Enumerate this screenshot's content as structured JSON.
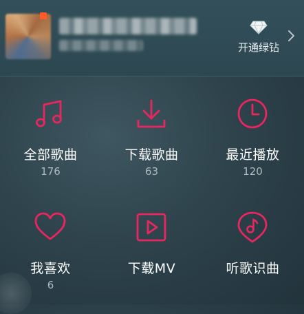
{
  "header": {
    "vip_label": "开通绿钻"
  },
  "tiles": [
    {
      "label": "全部歌曲",
      "count": "176",
      "icon": "music-note-icon"
    },
    {
      "label": "下载歌曲",
      "count": "63",
      "icon": "download-icon"
    },
    {
      "label": "最近播放",
      "count": "120",
      "icon": "clock-icon"
    },
    {
      "label": "我喜欢",
      "count": "6",
      "icon": "heart-icon"
    },
    {
      "label": "下载MV",
      "count": "",
      "icon": "play-video-icon"
    },
    {
      "label": "听歌识曲",
      "count": "",
      "icon": "music-recognition-icon"
    }
  ],
  "colors": {
    "accent": "#e8265f",
    "background": "#2e434c"
  }
}
